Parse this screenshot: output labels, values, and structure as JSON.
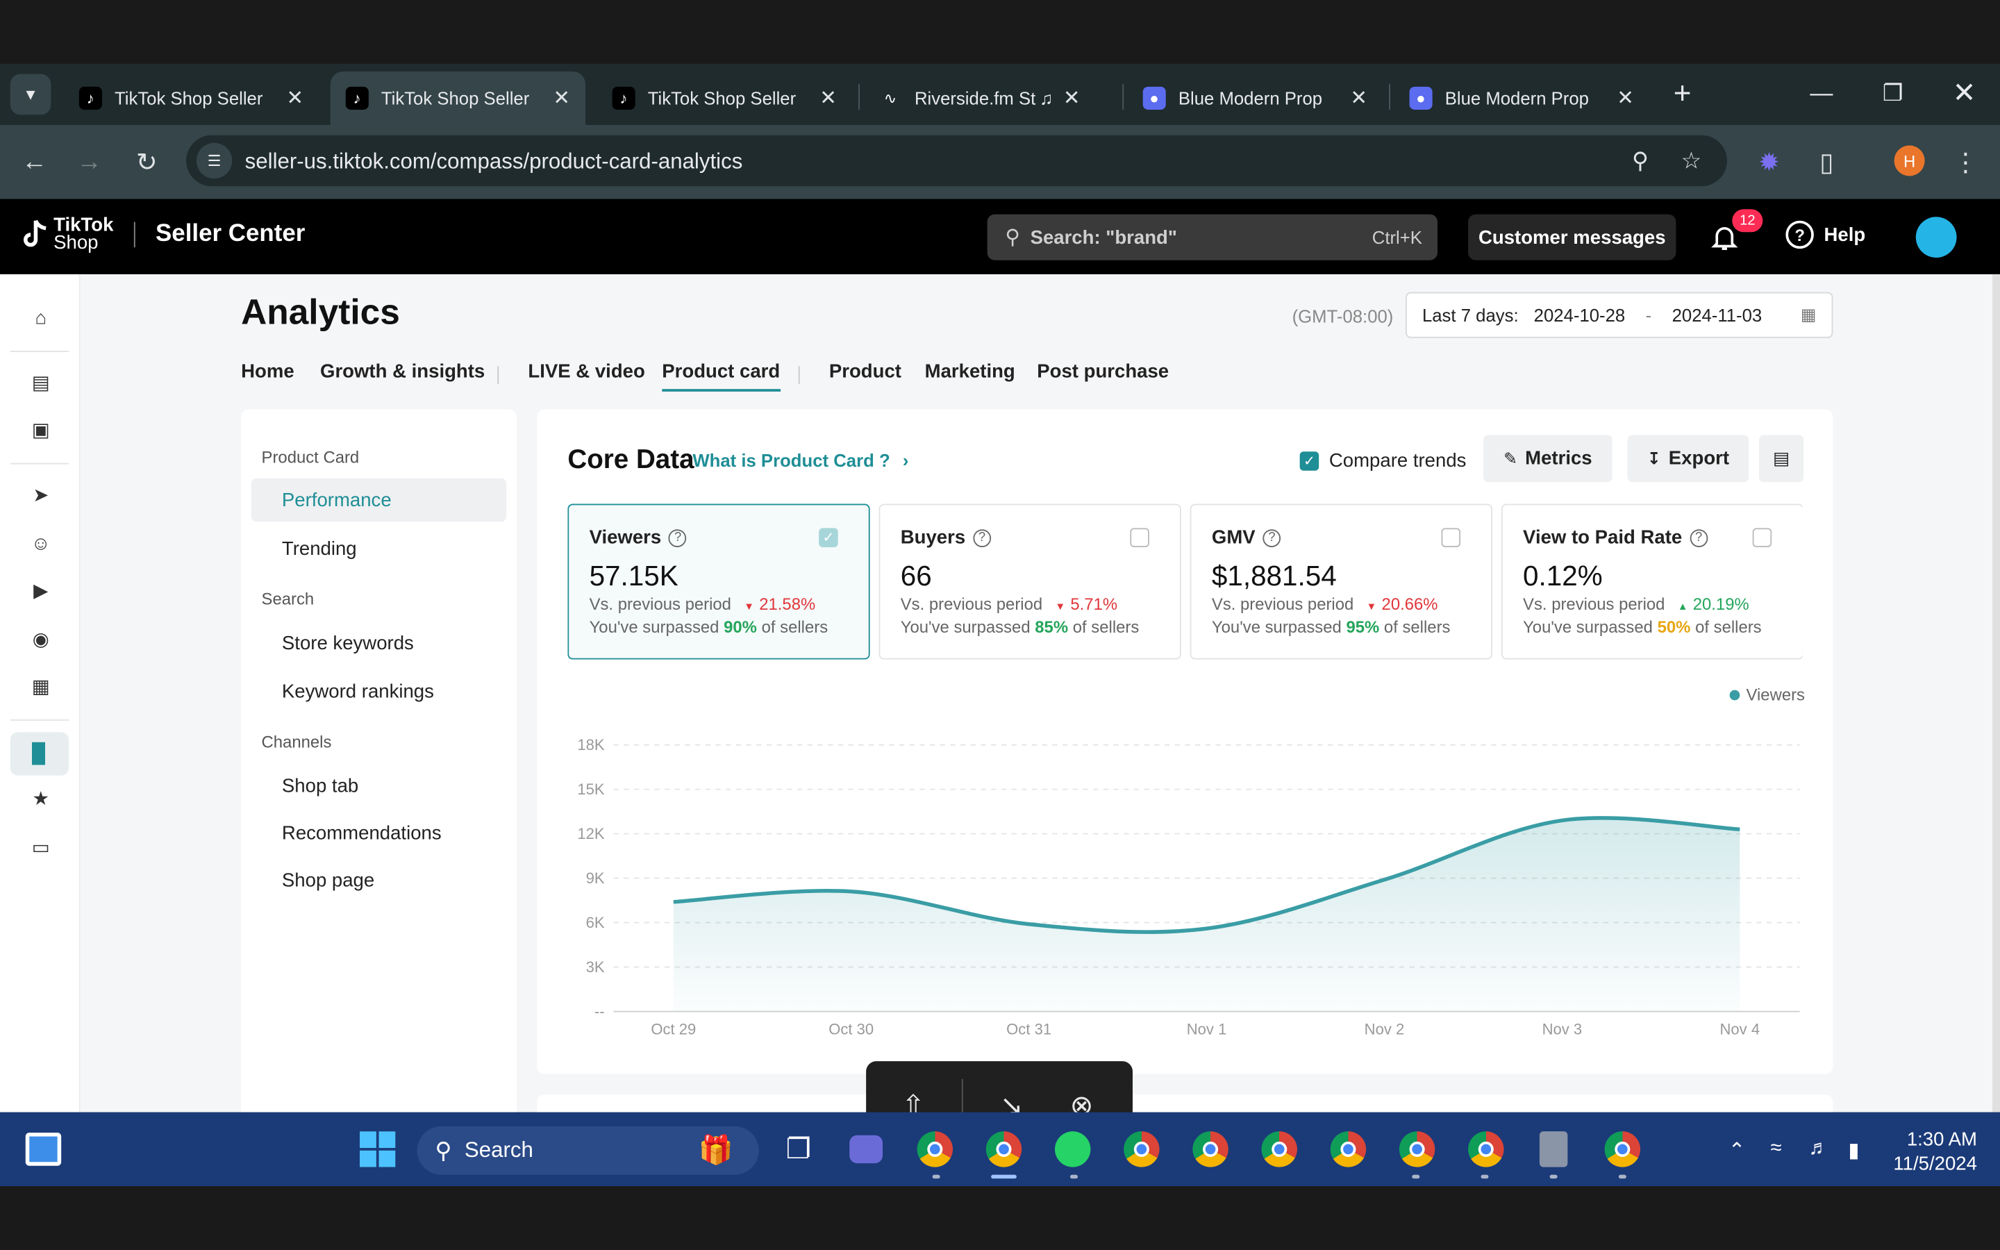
{
  "browser": {
    "tabs": [
      {
        "title": "TikTok Shop Seller",
        "favicon": "tiktok-icon",
        "active": false
      },
      {
        "title": "TikTok Shop Seller",
        "favicon": "tiktok-icon",
        "active": true
      },
      {
        "title": "TikTok Shop Seller",
        "favicon": "tiktok-icon",
        "active": false
      },
      {
        "title": "Riverside.fm St",
        "favicon": "riverside-icon",
        "active": false,
        "audio": true
      },
      {
        "title": "Blue Modern Prop",
        "favicon": "canva-icon",
        "active": false
      },
      {
        "title": "Blue Modern Prop",
        "favicon": "canva-icon",
        "active": false
      }
    ],
    "new_tab": "+",
    "url": "seller-us.tiktok.com/compass/product-card-analytics",
    "profile_initial": "H"
  },
  "header": {
    "logo_line1": "TikTok",
    "logo_line2": "Shop",
    "app_name": "Seller Center",
    "search_placeholder": "Search: \"brand\"",
    "search_shortcut": "Ctrl+K",
    "customer_messages": "Customer messages",
    "notifications_count": "12",
    "help": "Help"
  },
  "page": {
    "title": "Analytics",
    "timezone": "(GMT-08:00)",
    "date_label": "Last 7 days:",
    "date_start": "2024-10-28",
    "date_sep": "-",
    "date_end": "2024-11-03",
    "tabs": [
      "Home",
      "Growth & insights",
      "LIVE & video",
      "Product card",
      "Product",
      "Marketing",
      "Post purchase"
    ],
    "active_tab": "Product card"
  },
  "left_nav": {
    "sections": [
      {
        "title": "Product Card",
        "items": [
          "Performance",
          "Trending"
        ]
      },
      {
        "title": "Search",
        "items": [
          "Store keywords",
          "Keyword rankings"
        ]
      },
      {
        "title": "Channels",
        "items": [
          "Shop tab",
          "Recommendations",
          "Shop page"
        ]
      }
    ],
    "active_item": "Performance"
  },
  "core": {
    "title": "Core Data",
    "what_link": "What is Product Card ?",
    "compare_trends": "Compare trends",
    "compare_checked": true,
    "metrics_btn": "Metrics",
    "export_btn": "Export"
  },
  "metric_cards": [
    {
      "name": "Viewers",
      "value": "57.15K",
      "vs_label": "Vs. previous period",
      "change": "21.58%",
      "direction": "down",
      "sur_prefix": "You've surpassed",
      "sur_pct": "90%",
      "sur_suffix": "of sellers",
      "pct_color": "green",
      "selected": true
    },
    {
      "name": "Buyers",
      "value": "66",
      "vs_label": "Vs. previous period",
      "change": "5.71%",
      "direction": "down",
      "sur_prefix": "You've surpassed",
      "sur_pct": "85%",
      "sur_suffix": "of sellers",
      "pct_color": "green",
      "selected": false
    },
    {
      "name": "GMV",
      "value": "$1,881.54",
      "vs_label": "Vs. previous period",
      "change": "20.66%",
      "direction": "down",
      "sur_prefix": "You've surpassed",
      "sur_pct": "95%",
      "sur_suffix": "of sellers",
      "pct_color": "green",
      "selected": false
    },
    {
      "name": "View to Paid Rate",
      "value": "0.12%",
      "vs_label": "Vs. previous period",
      "change": "20.19%",
      "direction": "up",
      "sur_prefix": "You've surpassed",
      "sur_pct": "50%",
      "sur_suffix": "of sellers",
      "pct_color": "amber",
      "selected": false
    }
  ],
  "chart_data": {
    "type": "area",
    "x": [
      "Oct 29",
      "Oct 30",
      "Oct 31",
      "Nov 1",
      "Nov 2",
      "Nov 3",
      "Nov 4"
    ],
    "series": [
      {
        "name": "Viewers",
        "values": [
          7400,
          8100,
          5900,
          5600,
          8900,
          12900,
          12300
        ],
        "color": "#3a9da5"
      }
    ],
    "y_ticks": [
      "--",
      "3K",
      "6K",
      "9K",
      "12K",
      "15K",
      "18K"
    ],
    "ylim": [
      0,
      18000
    ],
    "grid": true,
    "legend": "top-right"
  },
  "taskbar": {
    "search": "Search",
    "time": "1:30 AM",
    "date": "11/5/2024"
  },
  "colors": {
    "accent": "#1f8e96",
    "down": "#e0363b",
    "up": "#25a55b",
    "amber": "#e7a613"
  }
}
